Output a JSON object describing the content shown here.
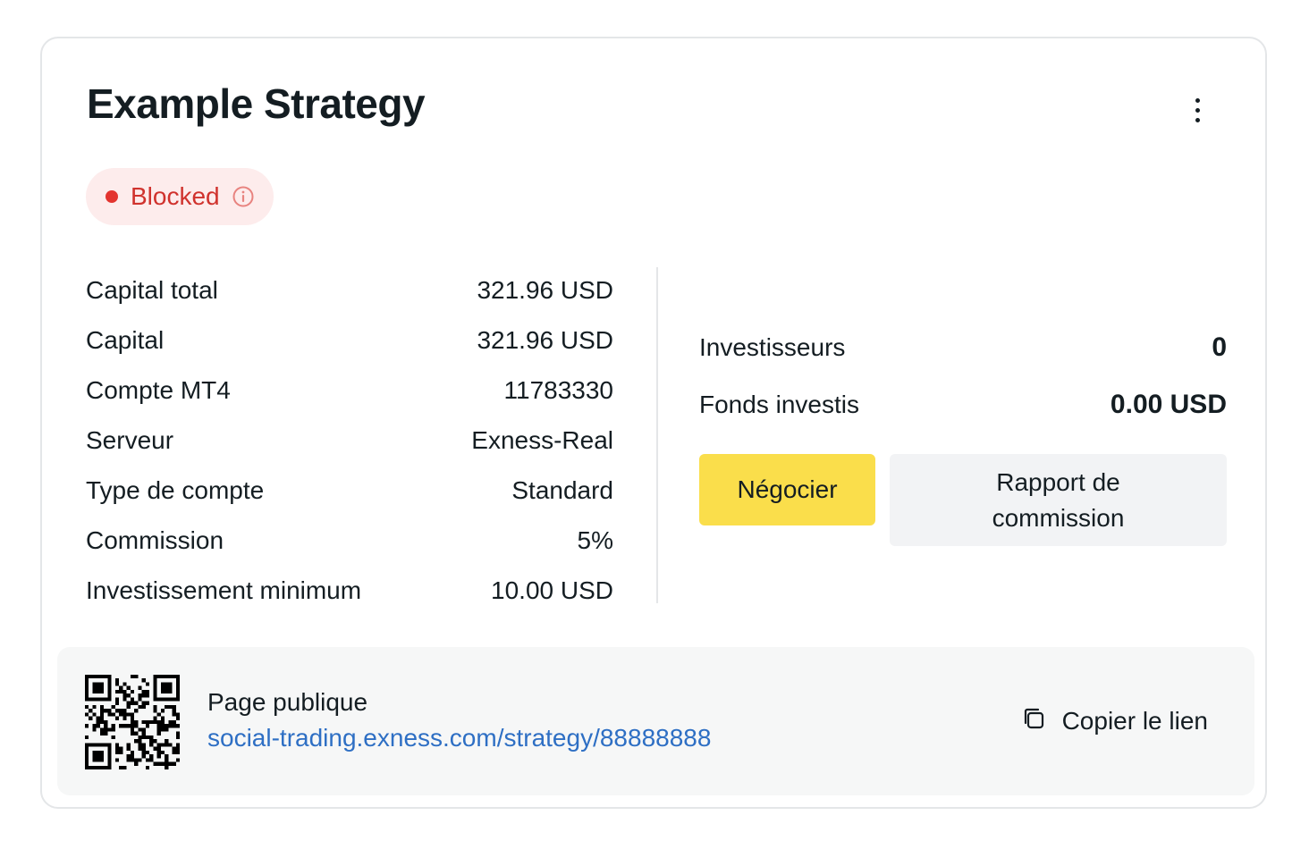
{
  "strategy": {
    "title": "Example Strategy",
    "status": {
      "label": "Blocked",
      "color": "#e3342f"
    }
  },
  "stats": [
    {
      "label": "Capital total",
      "value": "321.96 USD"
    },
    {
      "label": "Capital",
      "value": "321.96 USD"
    },
    {
      "label": "Compte MT4",
      "value": "11783330"
    },
    {
      "label": "Serveur",
      "value": "Exness-Real"
    },
    {
      "label": "Type de compte",
      "value": "Standard"
    },
    {
      "label": "Commission",
      "value": "5%"
    },
    {
      "label": "Investissement minimum",
      "value": "10.00 USD"
    }
  ],
  "summary": {
    "investors_label": "Investisseurs",
    "investors_value": "0",
    "funds_label": "Fonds investis",
    "funds_value": "0.00 USD"
  },
  "actions": {
    "trade_label": "Négocier",
    "report_label": "Rapport de commission",
    "trade_color": "#fade4b"
  },
  "public_page": {
    "label": "Page publique",
    "url": "social-trading.exness.com/strategy/88888888",
    "copy_label": "Copier le lien",
    "link_color": "#2e6fc4"
  },
  "icons": {
    "menu": "kebab-menu-icon",
    "info": "info-circle-icon",
    "copy": "copy-icon",
    "qr": "qr-code-icon"
  }
}
